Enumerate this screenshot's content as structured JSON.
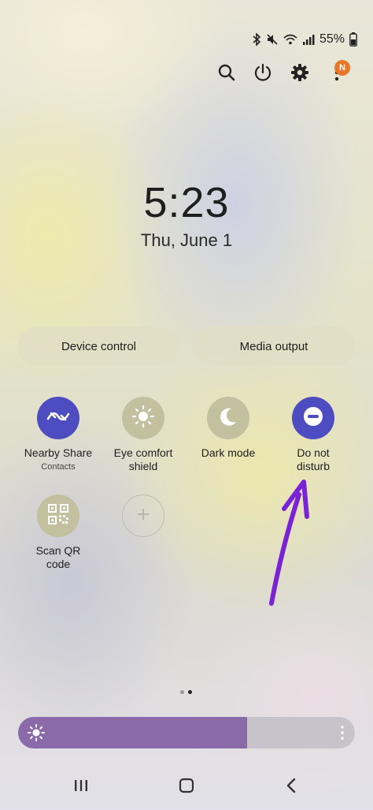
{
  "status_bar": {
    "battery_text": "55%",
    "icons": [
      "bluetooth-icon",
      "mute-vibrate-icon",
      "wifi-icon",
      "signal-icon",
      "battery-icon"
    ]
  },
  "top_actions": {
    "notification_badge": "N",
    "icons": [
      "search-icon",
      "power-icon",
      "gear-icon",
      "more-vert-icon"
    ]
  },
  "clock": {
    "time": "5:23",
    "date": "Thu, June 1"
  },
  "pills": {
    "device_control": "Device control",
    "media_output": "Media output"
  },
  "tiles": [
    {
      "id": "nearby-share",
      "label": "Nearby Share",
      "sublabel": "Contacts",
      "state": "on",
      "icon": "nearby-share-icon"
    },
    {
      "id": "eye-comfort",
      "label": "Eye comfort shield",
      "state": "off",
      "icon": "eye-comfort-icon"
    },
    {
      "id": "dark-mode",
      "label": "Dark mode",
      "state": "off",
      "icon": "moon-icon"
    },
    {
      "id": "do-not-disturb",
      "label": "Do not disturb",
      "state": "on",
      "icon": "do-not-disturb-icon"
    },
    {
      "id": "scan-qr",
      "label": "Scan QR code",
      "state": "off",
      "icon": "qr-code-icon"
    },
    {
      "id": "add",
      "label": "",
      "icon": "plus-icon"
    }
  ],
  "page_indicator": {
    "pages": 2,
    "current": 2
  },
  "brightness": {
    "level": 0.68,
    "icon": "sun-icon"
  },
  "colors": {
    "tile_on": "#4e4cc1",
    "tile_off": "#c3c0a0",
    "brightness_fill": "#8a6aa8",
    "annotation_arrow": "#7a22d6",
    "badge": "#e8762a"
  },
  "nav_bar": {
    "icons": [
      "recent-apps-icon",
      "home-icon",
      "back-icon"
    ]
  }
}
